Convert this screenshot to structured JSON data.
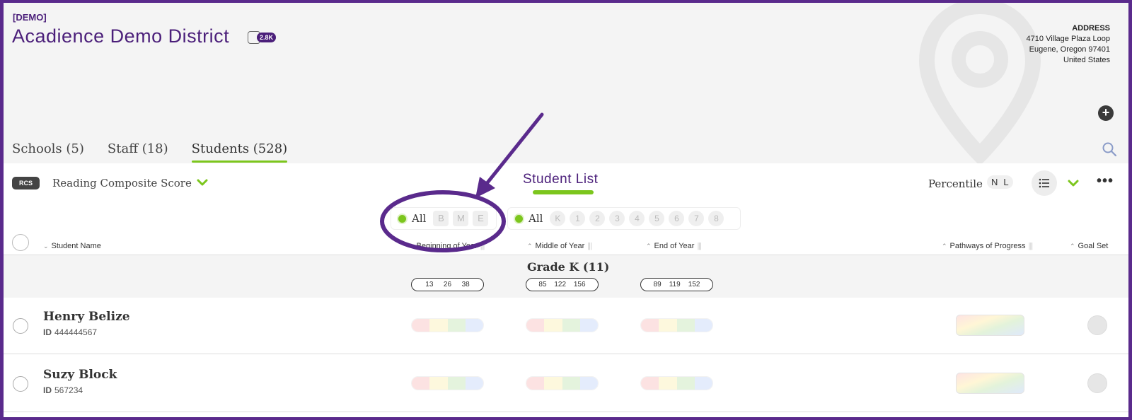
{
  "header": {
    "demo_tag": "[DEMO]",
    "district_name": "Acadience Demo District",
    "badge_count": "2.8K",
    "address": {
      "heading": "ADDRESS",
      "line1": "4710 Village Plaza Loop",
      "line2": "Eugene, Oregon 97401",
      "line3": "United States"
    }
  },
  "tabs": [
    {
      "label": "Schools (5)"
    },
    {
      "label": "Staff (18)"
    },
    {
      "label": "Students (528)"
    }
  ],
  "toolbar": {
    "measure_code": "RCS",
    "measure_label": "Reading Composite Score",
    "list_title": "Student List",
    "percentile_label": "Percentile",
    "toggle_n": "N",
    "toggle_l": "L"
  },
  "filters": {
    "period_all": "All",
    "periods": [
      "B",
      "M",
      "E"
    ],
    "grade_all": "All",
    "grades": [
      "K",
      "1",
      "2",
      "3",
      "4",
      "5",
      "6",
      "7",
      "8"
    ]
  },
  "columns": {
    "student_name": "Student Name",
    "boy": "Beginning of Year",
    "moy": "Middle of Year",
    "eoy": "End of Year",
    "pathways": "Pathways of Progress",
    "goal_set": "Goal Set"
  },
  "group": {
    "label": "Grade K (11)",
    "boy_benchmarks": [
      "13",
      "26",
      "38"
    ],
    "moy_benchmarks": [
      "85",
      "122",
      "156"
    ],
    "eoy_benchmarks": [
      "89",
      "119",
      "152"
    ]
  },
  "students": [
    {
      "name": "Henry Belize",
      "id_label": "ID",
      "id": "444444567"
    },
    {
      "name": "Suzy Block",
      "id_label": "ID",
      "id": "567234"
    }
  ],
  "colors": {
    "border": "#5a2a8c",
    "brand_purple": "#4b1f7a",
    "accent_green": "#7cc61d",
    "annotation_purple": "#5a2a8c"
  }
}
